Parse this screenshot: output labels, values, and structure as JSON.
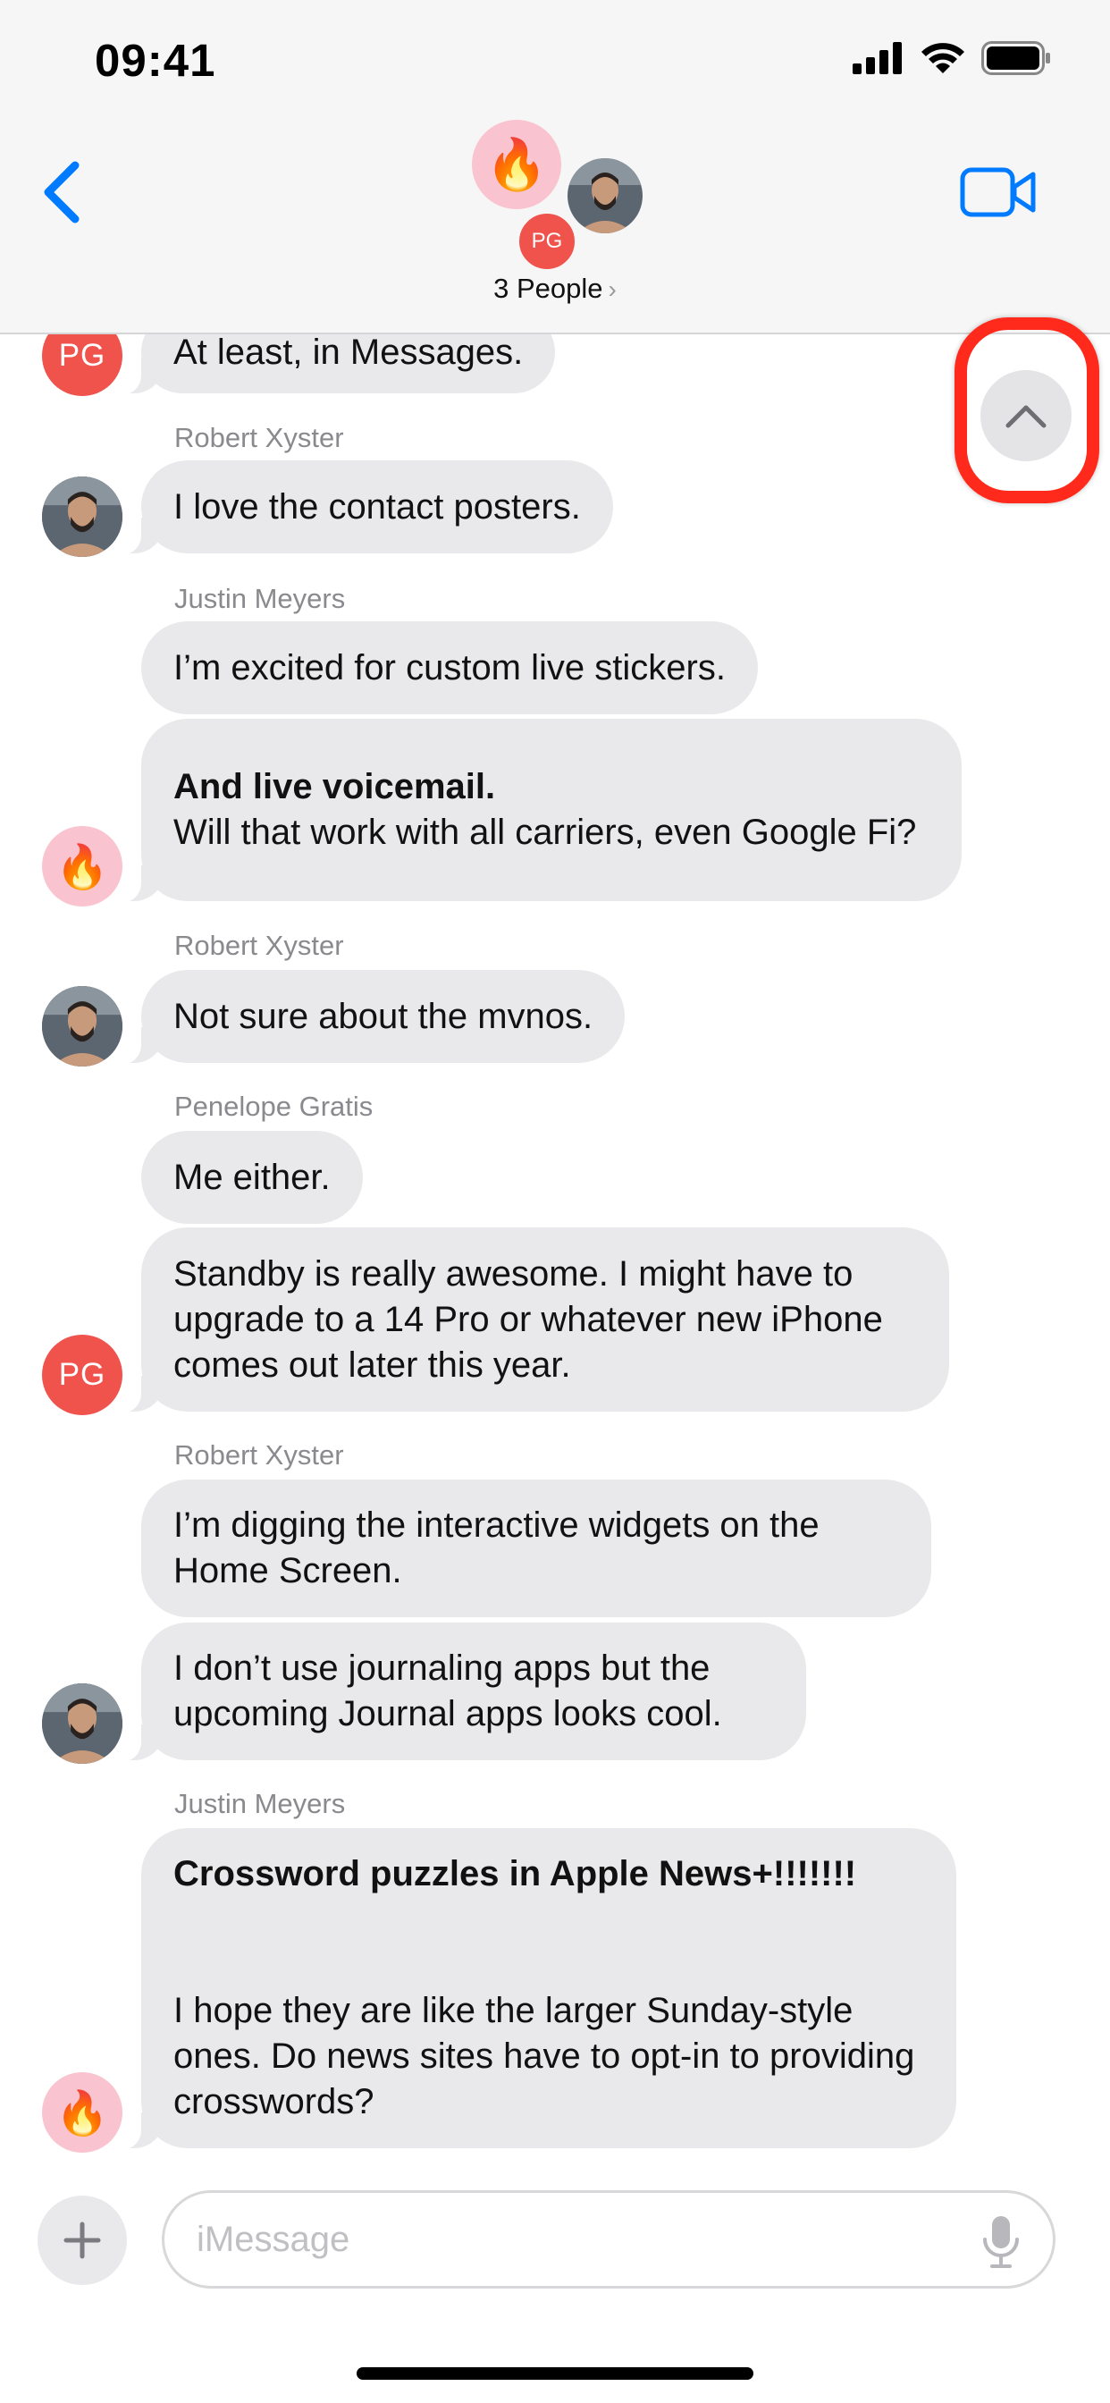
{
  "status_bar": {
    "time": "09:41"
  },
  "header": {
    "group_name": "3 People",
    "chevron": "›",
    "small_avatar_initials": "PG",
    "flame_emoji": "🔥"
  },
  "messages": [
    {
      "id": "m0",
      "text": "At least, in Messages.",
      "avatar": "PG"
    },
    {
      "id": "m1",
      "sender": "Robert Xyster",
      "text": "I love the contact posters."
    },
    {
      "id": "m2",
      "sender": "Justin Meyers",
      "text": "I’m excited for custom live stickers."
    },
    {
      "id": "m3",
      "bold": "And live voicemail.",
      "text": "Will that work with all carriers, even Google Fi?"
    },
    {
      "id": "m4",
      "sender": "Robert Xyster",
      "text": "Not sure about the mvnos."
    },
    {
      "id": "m5",
      "sender": "Penelope Gratis",
      "text": "Me either."
    },
    {
      "id": "m6",
      "text": "Standby is really awesome. I might have to upgrade to a 14 Pro or whatever new iPhone comes out later this year.",
      "avatar": "PG"
    },
    {
      "id": "m7",
      "sender": "Robert Xyster",
      "text": "I’m digging the interactive widgets on the Home Screen."
    },
    {
      "id": "m8",
      "text": "I don’t use journaling apps but the upcoming Journal apps looks cool."
    },
    {
      "id": "m9",
      "sender": "Justin Meyers",
      "bold": "Crossword puzzles in Apple News+!!!!!!!",
      "text": "I hope they are like the larger Sunday-style ones. Do news sites have to opt-in to providing crosswords?"
    }
  ],
  "input": {
    "placeholder": "iMessage"
  },
  "colors": {
    "accent": "#007aff",
    "highlight": "#ff2a1c",
    "bubble": "#e9e9eb",
    "pg_avatar": "#f0524c",
    "flame_avatar": "#f9c3cf"
  },
  "icons": [
    "back-chevron-icon",
    "video-camera-icon",
    "chevron-up-icon",
    "plus-icon",
    "microphone-icon",
    "signal-icon",
    "wifi-icon",
    "battery-icon"
  ]
}
